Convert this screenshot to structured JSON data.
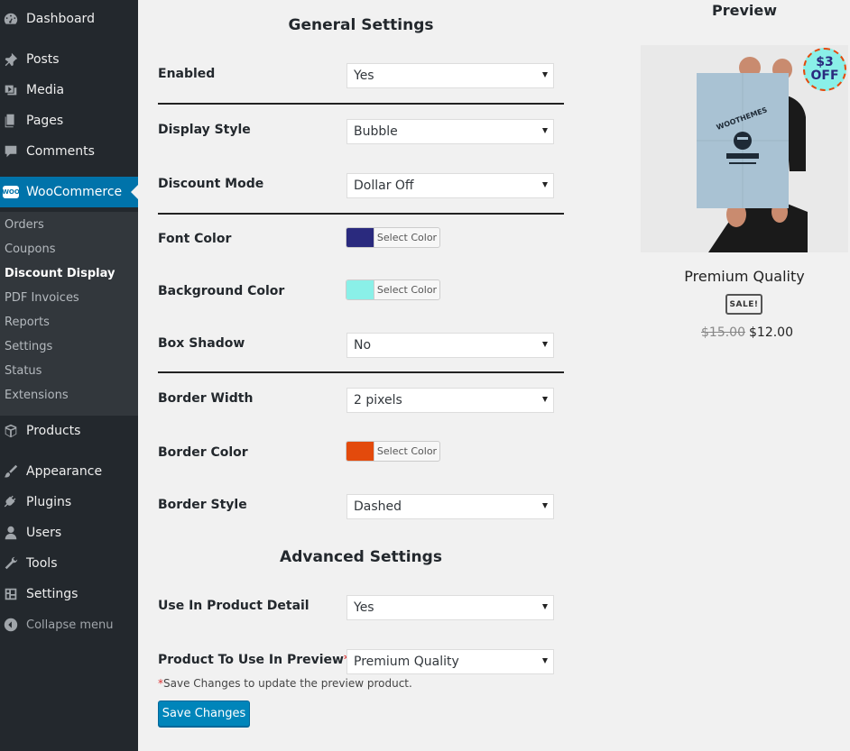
{
  "sidebar": {
    "menu": {
      "dashboard": "Dashboard",
      "posts": "Posts",
      "media": "Media",
      "pages": "Pages",
      "comments": "Comments",
      "woocommerce": "WooCommerce",
      "products": "Products",
      "appearance": "Appearance",
      "plugins": "Plugins",
      "users": "Users",
      "tools": "Tools",
      "settings": "Settings",
      "collapse": "Collapse menu"
    },
    "woo_badge": "WOO",
    "submenu": [
      "Orders",
      "Coupons",
      "Discount Display",
      "PDF Invoices",
      "Reports",
      "Settings",
      "Status",
      "Extensions"
    ],
    "current_submenu": "Discount Display"
  },
  "general": {
    "title": "General Settings",
    "enabled": {
      "label": "Enabled",
      "value": "Yes"
    },
    "display_style": {
      "label": "Display Style",
      "value": "Bubble"
    },
    "discount_mode": {
      "label": "Discount Mode",
      "value": "Dollar Off"
    },
    "font_color": {
      "label": "Font Color",
      "button": "Select Color",
      "color": "#2a2a7e"
    },
    "background_color": {
      "label": "Background Color",
      "button": "Select Color",
      "color": "#8af0e8"
    },
    "box_shadow": {
      "label": "Box Shadow",
      "value": "No"
    },
    "border_width": {
      "label": "Border Width",
      "value": "2 pixels"
    },
    "border_color": {
      "label": "Border Color",
      "button": "Select Color",
      "color": "#e34a0c"
    },
    "border_style": {
      "label": "Border Style",
      "value": "Dashed"
    }
  },
  "advanced": {
    "title": "Advanced Settings",
    "use_in_product_detail": {
      "label": "Use In Product Detail",
      "value": "Yes"
    },
    "product_to_preview": {
      "label": "Product To Use In Preview",
      "required_mark": "*",
      "value": "Premium Quality"
    },
    "note_mark": "*",
    "note": "Save Changes to update the preview product."
  },
  "save_button": "Save Changes",
  "preview": {
    "title": "Preview",
    "bubble_amount": "$3",
    "bubble_text": "OFF",
    "product_title": "Premium Quality",
    "sale_badge": "SALE!",
    "old_price": "$15.00",
    "new_price": "$12.00",
    "poster_text": "WOOTHEMES"
  },
  "colors": {
    "sidebar_bg": "#23282d",
    "submenu_bg": "#32373c",
    "active_bg": "#0073aa",
    "button_bg": "#0085ba"
  }
}
